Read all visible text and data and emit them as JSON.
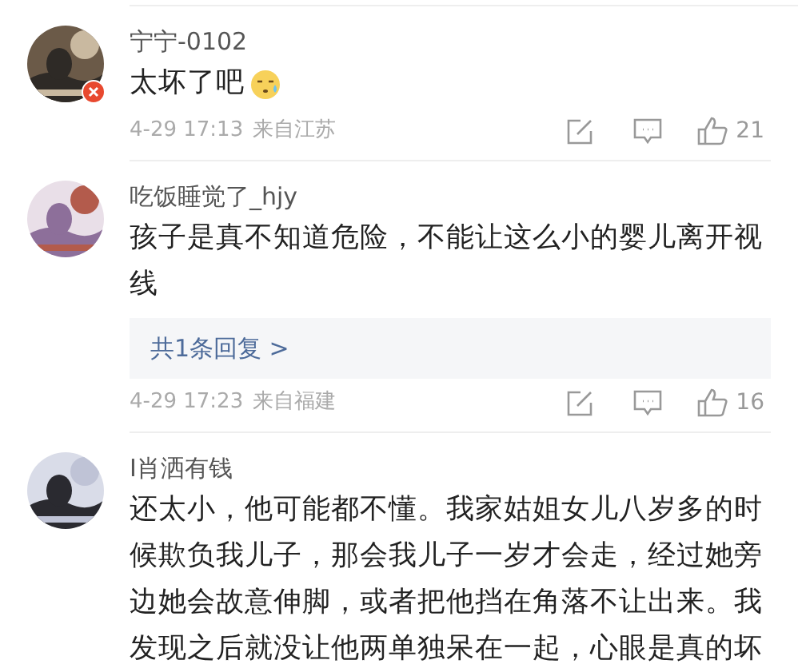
{
  "comments": [
    {
      "username": "宁宁-0102",
      "text": "太坏了吧",
      "emoji": true,
      "badge": true,
      "time": "4-29 17:13",
      "location": "来自江苏",
      "likes": "21"
    },
    {
      "username": "吃饭睡觉了_hjy",
      "text": "孩子是真不知道危险，不能让这么小的婴儿离开视线",
      "reply_link": "共1条回复 >",
      "time": "4-29 17:23",
      "location": "来自福建",
      "likes": "16"
    },
    {
      "username": "I肖洒有钱",
      "text": "还太小，他可能都不懂。我家姑姐女儿八岁多的时候欺负我儿子，那会我儿子一岁才会走，经过她旁边她会故意伸脚，或者把他挡在角落不让出来。我发现之后就没让他两单独呆在一起，心眼是真的坏"
    }
  ]
}
